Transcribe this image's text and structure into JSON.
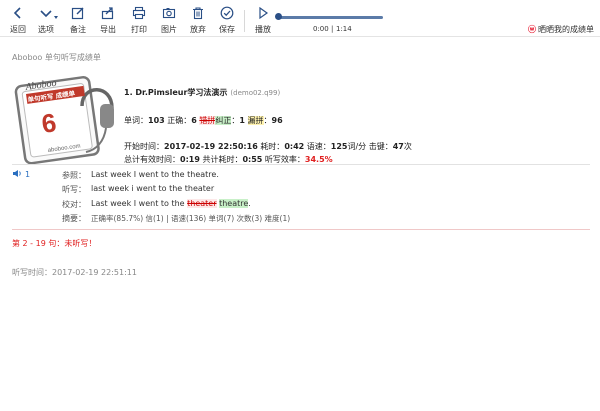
{
  "toolbar": {
    "back": "返回",
    "options": "选项",
    "notes": "备注",
    "export": "导出",
    "print": "打印",
    "image": "图片",
    "discard": "放弃",
    "save": "保存",
    "play": "播放"
  },
  "player": {
    "current": "0:00",
    "separator": "|",
    "total": "1:14"
  },
  "share": {
    "weibo_icon": "weibo-icon",
    "label": "晒晒我的成绩单"
  },
  "page": {
    "title": "Aboboo 单句听写成绩单"
  },
  "badge": {
    "brand": "Aboboo",
    "stamp": "单句听写 成绩单",
    "digit": "6",
    "site": "aboboo.com"
  },
  "lesson": {
    "title": "1. Dr.Pimsleur学习法演示",
    "file": "(demo02.q99)"
  },
  "stats": {
    "words_label": "单词：",
    "words": "103",
    "correct_label": "正确：",
    "correct": "6",
    "misspell_label": "错拼",
    "corrected_label": "纠正",
    "misspell_sep": "：",
    "misspell": "1",
    "missing_label": "漏拼",
    "missing_sep": "：",
    "missing": "96"
  },
  "timing": {
    "start_label": "开始时间：",
    "start": "2017-02-19 22:50:16",
    "elapsed_label": "耗时：",
    "elapsed": "0:42",
    "speed_label": "语速：",
    "speed": "125",
    "speed_unit": "词/分",
    "keys_label": "击键：",
    "keys": "47",
    "keys_unit": "次",
    "effective_label": "总计有效时间：",
    "effective": "0:19",
    "total_label": "共计耗时：",
    "total": "0:55",
    "efficiency_label": "听写效率：",
    "efficiency": "34.5%"
  },
  "sentence": {
    "number": "1",
    "ref_label": "参照：",
    "ref": "Last week I went to the theatre.",
    "dict_label": "听写：",
    "dict": "last week i went to the theater",
    "check_label": "校对：",
    "check_prefix": "Last week I went to the",
    "check_wrong": "theater",
    "check_right": "theatre",
    "check_suffix": ".",
    "summary_label": "摘要：",
    "summary": "正确率(85.7%) 信(1) | 语速(136) 单词(7) 次数(3) 难度(1)"
  },
  "missing_note": "第 2 - 19 句：未听写！",
  "dict_time": "听写时间：2017-02-19 22:51:11",
  "colors": {
    "accent": "#2a4f86",
    "error": "#e02020",
    "highlight_green": "#c8f0c8",
    "highlight_yellow": "#fff3b0"
  }
}
